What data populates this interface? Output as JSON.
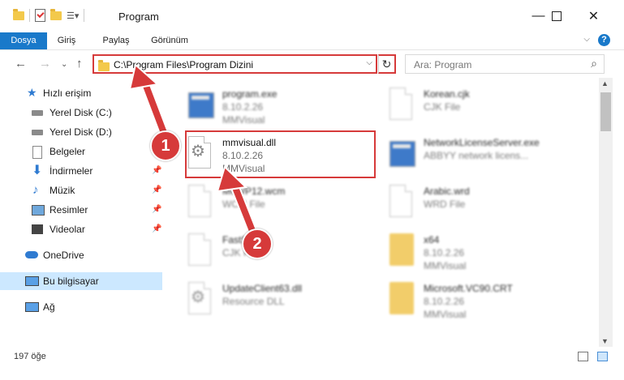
{
  "window": {
    "title": "Program"
  },
  "ribbon": {
    "tabs": [
      "Dosya",
      "Giriş",
      "Paylaş",
      "Görünüm"
    ]
  },
  "address": {
    "path": "C:\\Program Files\\Program Dizini"
  },
  "search": {
    "placeholder": "Ara: Program"
  },
  "sidebar": {
    "items": [
      {
        "label": "Hızlı erişim",
        "icon": "star-icon"
      },
      {
        "label": "Yerel Disk (C:)",
        "icon": "drive-icon"
      },
      {
        "label": "Yerel Disk (D:)",
        "icon": "drive-icon"
      },
      {
        "label": "Belgeler",
        "icon": "documents-icon"
      },
      {
        "label": "İndirmeler",
        "icon": "downloads-icon"
      },
      {
        "label": "Müzik",
        "icon": "music-icon"
      },
      {
        "label": "Resimler",
        "icon": "pictures-icon"
      },
      {
        "label": "Videolar",
        "icon": "videos-icon"
      },
      {
        "label": "OneDrive",
        "icon": "cloud-icon"
      },
      {
        "label": "Bu bilgisayar",
        "icon": "computer-icon"
      },
      {
        "label": "Ağ",
        "icon": "network-icon"
      }
    ]
  },
  "files": [
    {
      "name": "program.exe",
      "line2": "8.10.2.26",
      "line3": "MMVisual",
      "icon": "exe-icon"
    },
    {
      "name": "Korean.cjk",
      "line2": "CJK File",
      "line3": "",
      "icon": "document-icon"
    },
    {
      "name": "mmvisual.dll",
      "line2": "8.10.2.26",
      "line3": "MMVisual",
      "icon": "dll-gear-icon"
    },
    {
      "name": "NetworkLicenseServer.exe",
      "line2": "ABBYY network licens...",
      "line3": "",
      "icon": "exe-icon"
    },
    {
      "name": "MeWP12.wcm",
      "line2": "WCM File",
      "line3": "",
      "icon": "document-icon"
    },
    {
      "name": "Arabic.wrd",
      "line2": "WRD File",
      "line3": "",
      "icon": "document-icon"
    },
    {
      "name": "FastSe.cjk",
      "line2": "CJK File",
      "line3": "",
      "icon": "document-icon"
    },
    {
      "name": "x64",
      "line2": "8.10.2.26",
      "line3": "MMVisual",
      "icon": "package-icon"
    },
    {
      "name": "UpdateClient63.dll",
      "line2": "Resource DLL",
      "line3": "",
      "icon": "dll-gear-icon"
    },
    {
      "name": "Microsoft.VC90.CRT",
      "line2": "8.10.2.26",
      "line3": "MMVisual",
      "icon": "package-icon"
    }
  ],
  "status": {
    "count": "197 öğe"
  },
  "callouts": [
    "1",
    "2"
  ],
  "colors": {
    "accent": "#1979ca",
    "highlight": "#d63a3a",
    "selection": "#cce8ff"
  }
}
